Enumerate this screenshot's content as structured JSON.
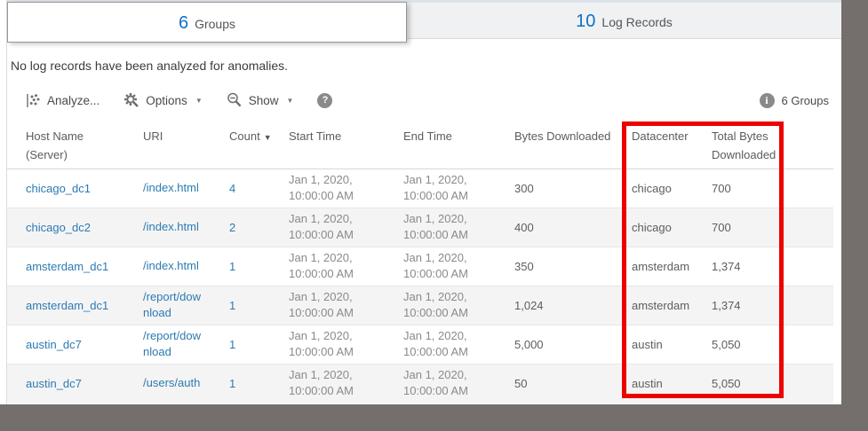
{
  "tabs": [
    {
      "count": "6",
      "label": "Groups",
      "active": true
    },
    {
      "count": "10",
      "label": "Log Records",
      "active": false
    }
  ],
  "message": "No log records have been analyzed for anomalies.",
  "toolbar": {
    "analyze_label": "Analyze...",
    "options_label": "Options",
    "show_label": "Show",
    "groups_summary": "6 Groups",
    "icons": {
      "analyze": "scatter-chart-icon",
      "options": "gear-icon",
      "show": "zoom-out-icon",
      "help": "help-icon",
      "info": "info-icon"
    }
  },
  "glyphs": {
    "caret": "▼",
    "sort_desc": "▼",
    "help": "?",
    "info": "i"
  },
  "table": {
    "headers": {
      "host": "Host Name (Server)",
      "uri": "URI",
      "count": "Count",
      "start": "Start Time",
      "end": "End Time",
      "bytes": "Bytes Downloaded",
      "datacenter": "Datacenter",
      "total": "Total Bytes Downloaded"
    },
    "rows": [
      {
        "host": "chicago_dc1",
        "uri": "/index.html",
        "count": "4",
        "start_date": "Jan 1, 2020,",
        "start_time": "10:00:00 AM",
        "end_date": "Jan 1, 2020,",
        "end_time": "10:00:00 AM",
        "bytes": "300",
        "datacenter": "chicago",
        "total": "700"
      },
      {
        "host": "chicago_dc2",
        "uri": "/index.html",
        "count": "2",
        "start_date": "Jan 1, 2020,",
        "start_time": "10:00:00 AM",
        "end_date": "Jan 1, 2020,",
        "end_time": "10:00:00 AM",
        "bytes": "400",
        "datacenter": "chicago",
        "total": "700"
      },
      {
        "host": "amsterdam_dc1",
        "uri": "/index.html",
        "count": "1",
        "start_date": "Jan 1, 2020,",
        "start_time": "10:00:00 AM",
        "end_date": "Jan 1, 2020,",
        "end_time": "10:00:00 AM",
        "bytes": "350",
        "datacenter": "amsterdam",
        "total": "1,374"
      },
      {
        "host": "amsterdam_dc1",
        "uri": "/report/download",
        "count": "1",
        "start_date": "Jan 1, 2020,",
        "start_time": "10:00:00 AM",
        "end_date": "Jan 1, 2020,",
        "end_time": "10:00:00 AM",
        "bytes": "1,024",
        "datacenter": "amsterdam",
        "total": "1,374"
      },
      {
        "host": "austin_dc7",
        "uri": "/report/download",
        "count": "1",
        "start_date": "Jan 1, 2020,",
        "start_time": "10:00:00 AM",
        "end_date": "Jan 1, 2020,",
        "end_time": "10:00:00 AM",
        "bytes": "5,000",
        "datacenter": "austin",
        "total": "5,050"
      },
      {
        "host": "austin_dc7",
        "uri": "/users/auth",
        "count": "1",
        "start_date": "Jan 1, 2020,",
        "start_time": "10:00:00 AM",
        "end_date": "Jan 1, 2020,",
        "end_time": "10:00:00 AM",
        "bytes": "50",
        "datacenter": "austin",
        "total": "5,050"
      }
    ]
  },
  "colors": {
    "accent_blue": "#0c72c7",
    "link_blue": "#2b7bb2",
    "highlight_red": "#ec0000",
    "desktop_gray": "#746e6d",
    "row_alt": "#f4f4f5"
  }
}
